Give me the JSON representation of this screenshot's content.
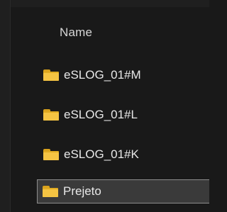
{
  "columns": {
    "name_header": "Name"
  },
  "files": [
    {
      "label": "eSLOG_01#M",
      "icon": "folder-icon",
      "selected": false
    },
    {
      "label": "eSLOG_01#L",
      "icon": "folder-icon",
      "selected": false
    },
    {
      "label": "eSLOG_01#K",
      "icon": "folder-icon",
      "selected": false
    },
    {
      "label": "Prejeto",
      "icon": "folder-icon",
      "selected": true
    }
  ],
  "colors": {
    "background": "#191919",
    "folder_front": "#f5c443",
    "folder_back": "#e0ab22",
    "selection_bg": "#3a3a3a",
    "selection_border": "#8d8d8d",
    "text": "#e8e8e8"
  }
}
